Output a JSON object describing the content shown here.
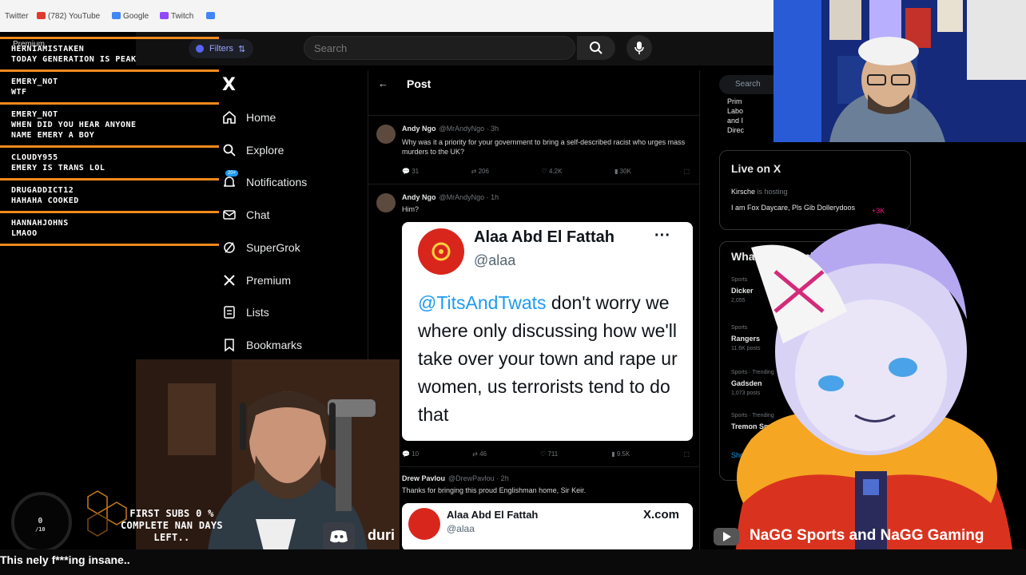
{
  "browser": {
    "tabs": [
      {
        "label": "Twitter",
        "color": "#555"
      },
      {
        "label": "(782) YouTube",
        "color": "#e03a2e"
      },
      {
        "label": "Google",
        "color": "#4285f4"
      },
      {
        "label": "Twitch",
        "color": "#9146ff"
      }
    ]
  },
  "header": {
    "premium_label": "Premium",
    "filters_label": "Filters",
    "search_placeholder": "Search"
  },
  "chat": [
    {
      "user": "HERNIAMISTAKEN",
      "text": "TODAY GENERATION IS PEAK"
    },
    {
      "user": "EMERY_NOT",
      "text": "WTF"
    },
    {
      "user": "EMERY_NOT",
      "text": "WHEN DID YOU HEAR ANYONE NAME EMERY A BOY"
    },
    {
      "user": "CLOUDY955",
      "text": "EMERY IS TRANS LOL"
    },
    {
      "user": "DRUGADDICT12",
      "text": "HAHAHA COOKED"
    },
    {
      "user": "HANNAHJOHNS",
      "text": "LMAOO"
    }
  ],
  "x_sidebar": {
    "logo": "X",
    "items": [
      {
        "label": "Home",
        "icon": "home-icon"
      },
      {
        "label": "Explore",
        "icon": "search-icon"
      },
      {
        "label": "Notifications",
        "icon": "bell-icon",
        "badge": "20+"
      },
      {
        "label": "Chat",
        "icon": "mail-icon"
      },
      {
        "label": "SuperGrok",
        "icon": "grok-icon"
      },
      {
        "label": "Premium",
        "icon": "x-icon"
      },
      {
        "label": "Lists",
        "icon": "list-icon"
      },
      {
        "label": "Bookmarks",
        "icon": "bookmark-icon"
      }
    ]
  },
  "feed": {
    "title": "Post",
    "tweet1": {
      "name": "Andy Ngo",
      "handle": "@MrAndyNgo · 3h",
      "text": "Why was it a priority for your government to bring a self-described racist who urges mass murders to the UK?",
      "replies": "31",
      "reposts": "206",
      "likes": "4.2K",
      "views": "30K"
    },
    "tweet2": {
      "name": "Andy Ngo",
      "handle": "@MrAndyNgo · 1h",
      "text": "Him?",
      "replies": "10",
      "reposts": "46",
      "likes": "711",
      "views": "9.5K",
      "card": {
        "name": "Alaa Abd El Fattah",
        "handle": "@alaa",
        "mention": "@TitsAndTwats",
        "text": " don't worry we where only discussing how we'll take over your town and rape ur women, us terrorists tend to do that"
      }
    },
    "tweet3": {
      "name": "Drew Pavlou",
      "handle": "@DrewPavlou · 2h",
      "text": "Thanks for bringing this proud Englishman home, Sir Keir.",
      "card": {
        "name": "Alaa Abd El Fattah",
        "handle": "@alaa",
        "brand": "X.com"
      }
    }
  },
  "right": {
    "search": "Search",
    "live_title": "Live on X",
    "live_user": "Kirsche",
    "live_status": "is hosting",
    "live_text": "I am Fox Daycare, Pls Gib Dollerydoos",
    "live_count": "+3K",
    "happening_title": "What's happening",
    "trends": [
      {
        "meta": "Sports",
        "name": "Dicker",
        "count": "2,055"
      },
      {
        "meta": "Sports",
        "name": "Rangers",
        "count": "11.6K posts"
      },
      {
        "meta": "Sports · Trending",
        "name": "Gadsden",
        "count": "1,073 posts"
      },
      {
        "meta": "Sports · Trending",
        "name": "Tremon Sm",
        "count": ""
      }
    ],
    "show_more": "Show more",
    "partial_text": [
      "Prim",
      "Labo",
      "and I",
      "Direc"
    ]
  },
  "overlay": {
    "ring_count": "0",
    "ring_total": "/10",
    "sub_goal": "FIRST SUBS 0 % COMPLETE NAN DAYS LEFT..",
    "discord_name": "duri",
    "youtube_name": "NaGG Sports and NaGG Gaming",
    "ticker": "This         nely f***ing insane.."
  }
}
